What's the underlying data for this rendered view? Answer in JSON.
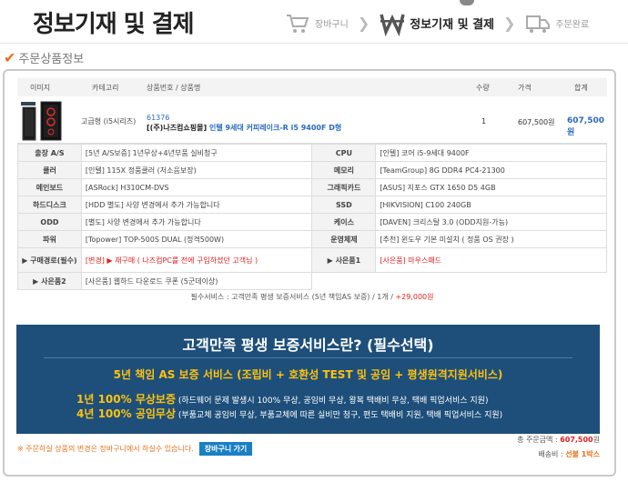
{
  "header": {
    "title": "정보기재 및 결제",
    "steps": [
      {
        "label": "장바구니",
        "icon": "cart-icon"
      },
      {
        "label": "정보기재 및 결제",
        "icon": "won-icon"
      },
      {
        "label": "주문완료",
        "icon": "delivery-icon"
      }
    ]
  },
  "section": {
    "title": "주문상품정보"
  },
  "product_table": {
    "columns": [
      "이미지",
      "카테고리",
      "상품번호 / 상품명",
      "수량",
      "가격",
      "합계"
    ],
    "row": {
      "category": "고급형 (i5시리즈)",
      "code": "61376",
      "seller": "[(주)나즈컴쇼핑몰]",
      "name": "인텔 9세대 커피레이크-R i5 9400F D형",
      "qty": "1",
      "price": "607,500원",
      "total": "607,500원"
    }
  },
  "specs": [
    {
      "l1": "출장 A/S",
      "v1": "[5년 A/S보증] 1년무상+4년부품 실비청구",
      "l2": "CPU",
      "v2": "[인텔] 코어 i5-9세대 9400F"
    },
    {
      "l1": "쿨러",
      "v1": "[인텔] 115X 정품쿨러 (저소음보장)",
      "l2": "메모리",
      "v2": "[TeamGroup] 8G DDR4 PC4-21300"
    },
    {
      "l1": "메인보드",
      "v1": "[ASRock] H310CM-DVS",
      "l2": "그래픽카드",
      "v2": "[ASUS] 지포스 GTX 1650 D5 4GB"
    },
    {
      "l1": "하드디스크",
      "v1": "[HDD 별도] 사양 변경에서 추가 가능합니다",
      "l2": "SSD",
      "v2": "[HIKVISION] C100 240GB"
    },
    {
      "l1": "ODD",
      "v1": "[별도] 사양 변경에서 추가 가능합니다",
      "l2": "케이스",
      "v2": "[DAVEN] 크리스탈 3.0 (ODD지원-가능)"
    },
    {
      "l1": "파워",
      "v1": "[Topower] TOP-500S DUAL (정격500W)",
      "l2": "운영체제",
      "v2": "[추천] 윈도우 기본 미설치 ( 정품 OS 권장 )"
    }
  ],
  "specs_extra": {
    "path_label": "▶ 구매경로(필수)",
    "path_change": "[변경]",
    "path_text": "▶ 재구매 ( 나즈컴PC를 전에 구입하셨던 고객님 )",
    "gift1_label": "▶ 사은품1",
    "gift1_tag": "[사은품]",
    "gift1_text": " 마우스패드",
    "gift2_label": "▶ 사은품2",
    "gift2_text": "[사은품] 웹하드 다운로드 쿠폰 (5군데이상)"
  },
  "warranty": {
    "text": "필수서비스 : 고객만족 평생 보증서비스 (5년 책임AS 보증) / 1개 / ",
    "price": "+29,000원"
  },
  "banner": {
    "title": "고객만족 평생 보증서비스란? (필수선택)",
    "subtitle": "5년 책임 AS 보증 서비스 (조립비 + 호환성 TEST 및 공임 + 평생원격지원서비스)",
    "line1_hl": "1년 100% 무상보증",
    "line1": " (하드웨어 문제 발생시 100% 무상, 공임비 무상, 왕복 택배비 무상, 택배 픽업서비스 지원)",
    "line2_hl": "4년 100% 공임무상",
    "line2": " (부품교체 공임비 무상, 부품교체에 따른 실비만 청구, 편도 택배비 지원, 택배 픽업서비스 지원)"
  },
  "footer": {
    "note": "※ 주문하실 상품의 변경은 장바구니에서 하실수 있습니다.",
    "cart_button": "장바구니 가기",
    "total_label": "총 주문금액 : ",
    "total_value": "607,500",
    "total_unit": "원",
    "ship_label": "배송비 : ",
    "ship_value": "선불 1박스"
  },
  "colors": {
    "accent": "#2a6bbd",
    "banner": "#1d4f7a",
    "highlight": "#ffc20e",
    "warning": "#e02020"
  }
}
